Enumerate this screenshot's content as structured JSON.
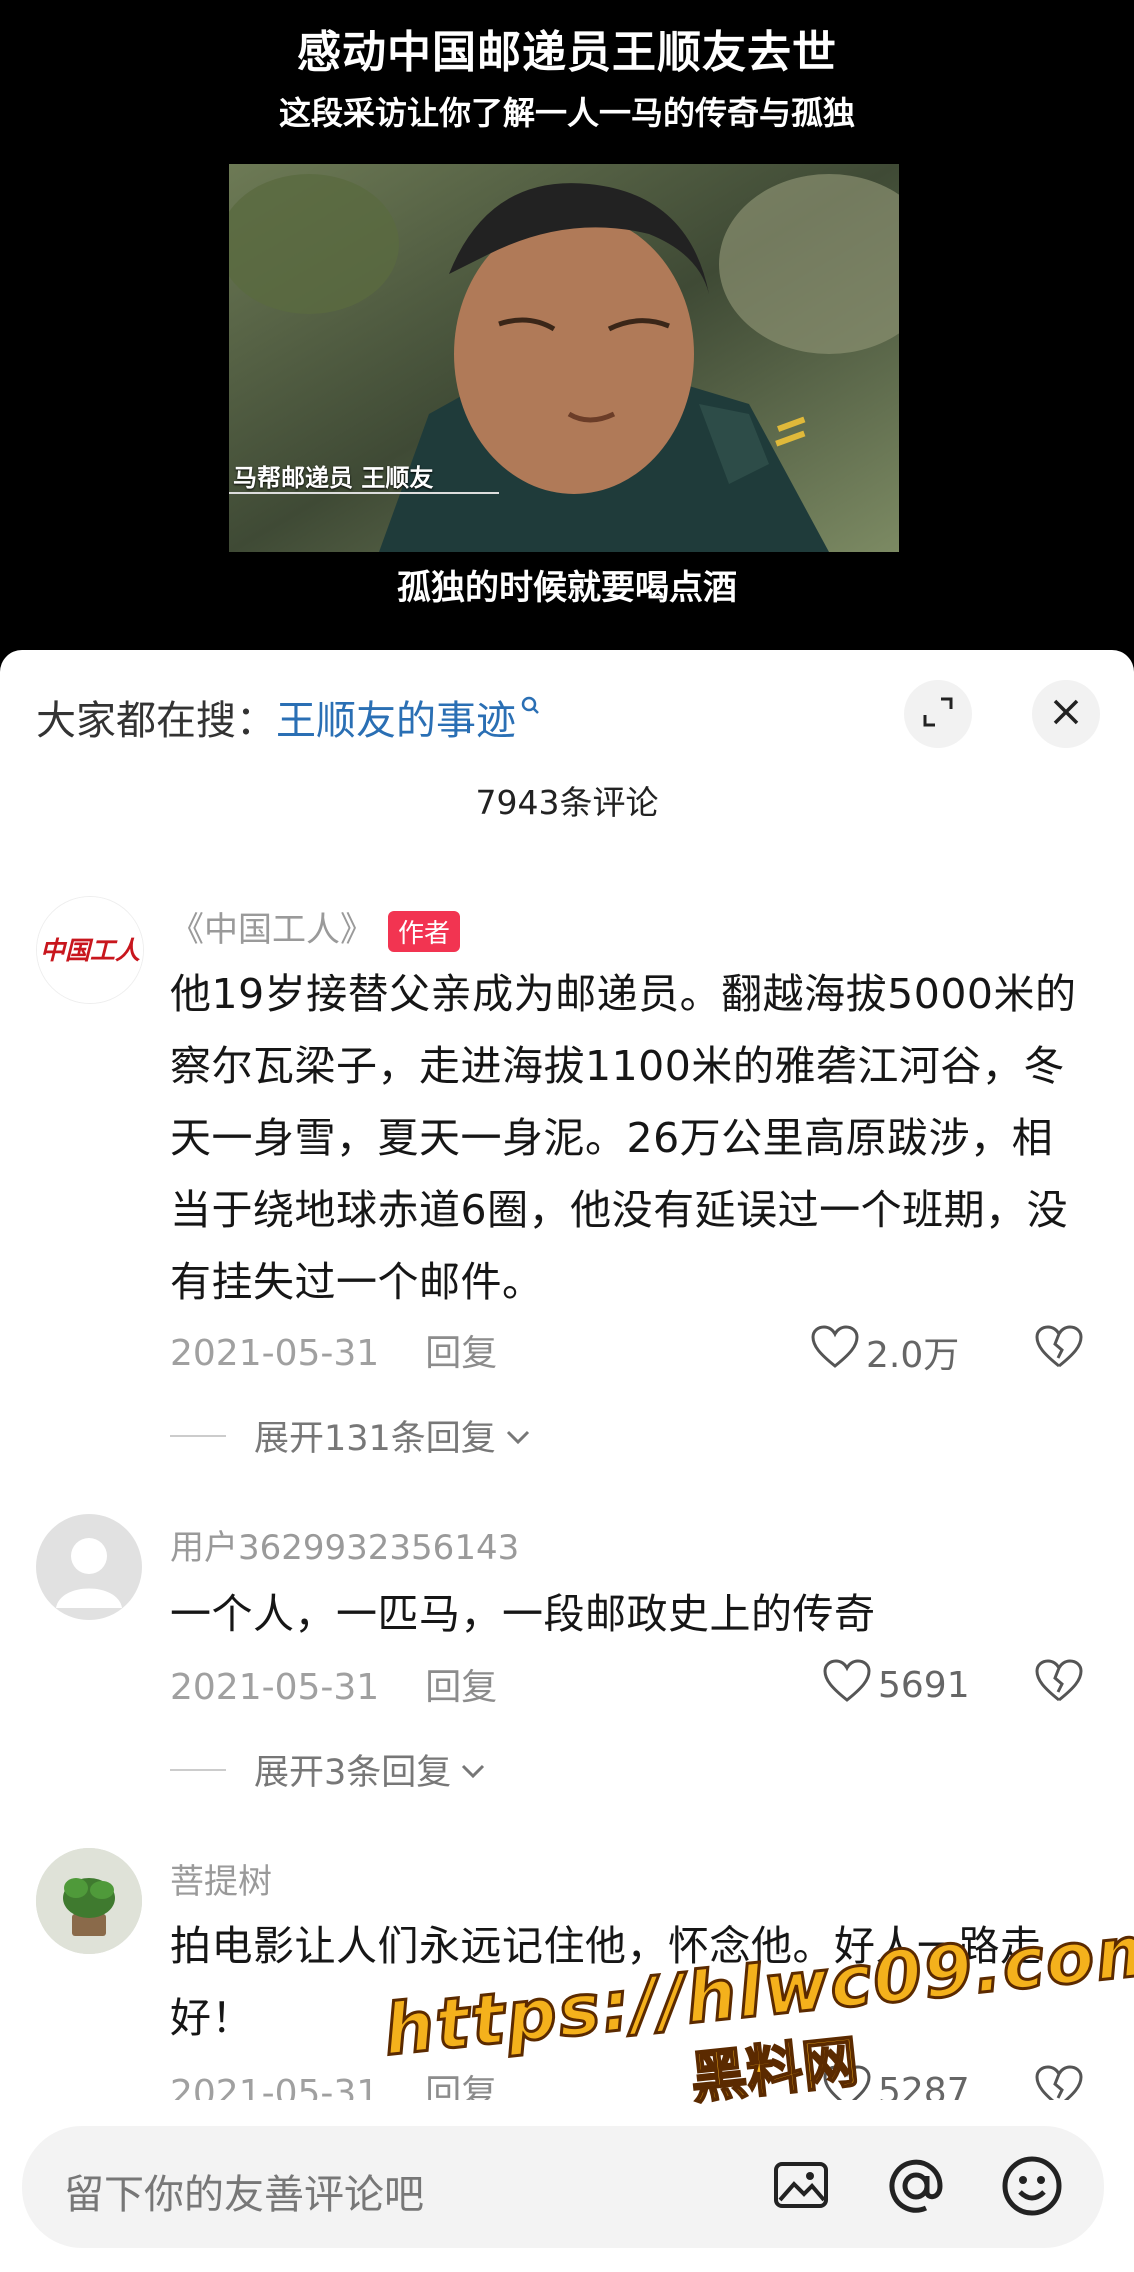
{
  "video": {
    "title": "感动中国邮递员王顺友去世",
    "subtitle": "这段采访让你了解一人一马的传奇与孤独",
    "frame_caption": "马帮邮递员  王顺友",
    "quote": "孤独的时候就要喝点酒"
  },
  "panel": {
    "search_label": "大家都在搜：",
    "search_link": "王顺友的事迹",
    "comment_count": "7943条评论"
  },
  "comments": [
    {
      "user": "《中国工人》",
      "avatar_text": "中国工人",
      "tag": "作者",
      "text": "他19岁接替父亲成为邮递员。翻越海拔5000米的察尔瓦梁子，走进海拔1100米的雅砻江河谷，冬天一身雪，夏天一身泥。26万公里高原跋涉，相当于绕地球赤道6圈，他没有延误过一个班期，没有挂失过一个邮件。",
      "date": "2021-05-31",
      "reply": "回复",
      "likes": "2.0万",
      "expand": "展开131条回复"
    },
    {
      "user": "用户3629932356143",
      "text": "一个人，一匹马，一段邮政史上的传奇",
      "date": "2021-05-31",
      "reply": "回复",
      "likes": "5691",
      "expand": "展开3条回复"
    },
    {
      "user": "菩提树",
      "text": "拍电影让人们永远记住他，怀念他。好人一路走好！",
      "date": "2021-05-31",
      "reply": "回复",
      "likes": "5287"
    }
  ],
  "input": {
    "placeholder": "留下你的友善评论吧"
  },
  "watermark": {
    "url": "https://hlwc09.com",
    "cn": "黑料网"
  },
  "colors": {
    "accent": "#f23451",
    "link": "#2a6fb4",
    "watermark": "#f4b11c"
  }
}
